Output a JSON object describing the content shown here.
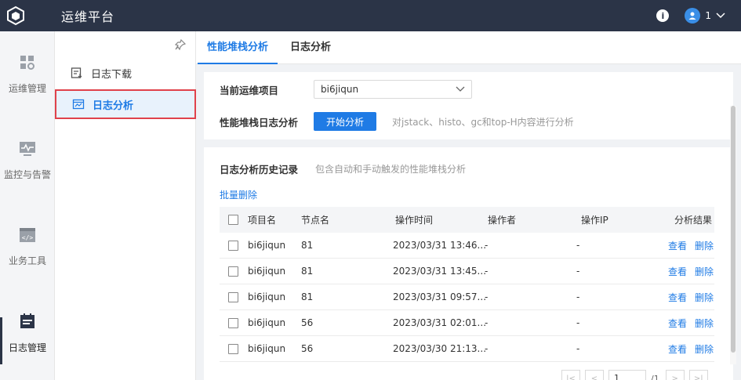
{
  "app": {
    "title": "运维平台"
  },
  "user": {
    "name": "1"
  },
  "rail": [
    {
      "label": "运维管理",
      "icon": "grid-settings-icon"
    },
    {
      "label": "监控与告警",
      "icon": "monitor-icon"
    },
    {
      "label": "业务工具",
      "icon": "code-window-icon"
    },
    {
      "label": "日志管理",
      "icon": "calendar-list-icon"
    }
  ],
  "subnav": [
    {
      "label": "日志下载",
      "icon": "log-download-icon"
    },
    {
      "label": "日志分析",
      "icon": "log-analysis-icon"
    }
  ],
  "tabs": [
    "性能堆栈分析",
    "日志分析"
  ],
  "form": {
    "project_label": "当前运维项目",
    "project_value": "bi6jiqun",
    "stack_label": "性能堆栈日志分析",
    "start_button": "开始分析",
    "start_hint": "对jstack、histo、gc和top-H内容进行分析"
  },
  "history": {
    "title": "日志分析历史记录",
    "desc": "包含自动和手动触发的性能堆栈分析",
    "bulk_delete": "批量删除",
    "columns": [
      "项目名",
      "节点名",
      "操作时间",
      "操作者",
      "操作IP",
      "分析结果"
    ],
    "view_label": "查看",
    "delete_label": "删除",
    "rows": [
      {
        "project": "bi6jiqun",
        "node": "81",
        "time": "2023/03/31 13:46...",
        "operator": "-",
        "ip": "-"
      },
      {
        "project": "bi6jiqun",
        "node": "81",
        "time": "2023/03/31 13:45...",
        "operator": "-",
        "ip": "-"
      },
      {
        "project": "bi6jiqun",
        "node": "81",
        "time": "2023/03/31 09:57...",
        "operator": "-",
        "ip": "-"
      },
      {
        "project": "bi6jiqun",
        "node": "56",
        "time": "2023/03/31 02:01...",
        "operator": "-",
        "ip": "-"
      },
      {
        "project": "bi6jiqun",
        "node": "56",
        "time": "2023/03/30 21:13...",
        "operator": "-",
        "ip": "-"
      }
    ]
  },
  "pager": {
    "page": "1",
    "total": "/1"
  }
}
